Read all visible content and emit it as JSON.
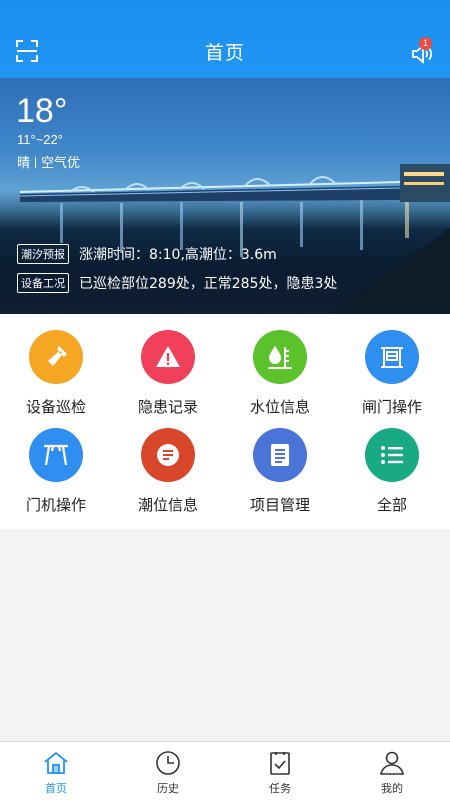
{
  "header": {
    "title": "首页",
    "notification_count": "1"
  },
  "weather": {
    "temperature": "18°",
    "range": "11°~22°",
    "condition": "晴",
    "air": "空气优"
  },
  "tide": {
    "tag": "潮汐预报",
    "text": "涨潮时间：8:10,高潮位：3.6m"
  },
  "equipment": {
    "tag": "设备工况",
    "text": "已巡检部位289处，正常285处，隐患3处"
  },
  "grid": {
    "items": [
      {
        "label": "设备巡检",
        "icon": "flashlight-icon",
        "color": "#f5a623"
      },
      {
        "label": "隐患记录",
        "icon": "warning-icon",
        "color": "#f1405a"
      },
      {
        "label": "水位信息",
        "icon": "water-level-icon",
        "color": "#5cc22c"
      },
      {
        "label": "闸门操作",
        "icon": "gate-icon",
        "color": "#2e8ff0"
      },
      {
        "label": "门机操作",
        "icon": "crane-icon",
        "color": "#2e8ff0"
      },
      {
        "label": "潮位信息",
        "icon": "tide-icon",
        "color": "#d9472b"
      },
      {
        "label": "项目管理",
        "icon": "project-list-icon",
        "color": "#4a74d8"
      },
      {
        "label": "全部",
        "icon": "all-menu-icon",
        "color": "#1aa985"
      }
    ]
  },
  "tabs": [
    {
      "label": "首页",
      "icon": "home-icon",
      "active": true
    },
    {
      "label": "历史",
      "icon": "clock-icon",
      "active": false
    },
    {
      "label": "任务",
      "icon": "task-icon",
      "active": false
    },
    {
      "label": "我的",
      "icon": "user-icon",
      "active": false
    }
  ],
  "colors": {
    "primary": "#2196f3",
    "background": "#f3f3f3"
  }
}
